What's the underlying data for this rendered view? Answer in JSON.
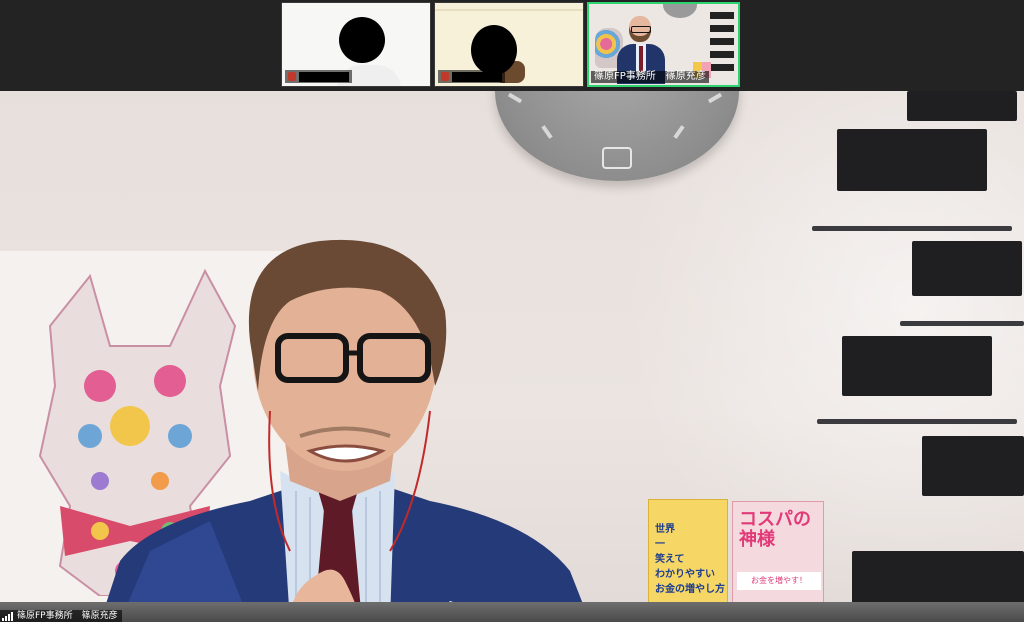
{
  "participants": [
    {
      "id": "p1",
      "name": ""
    },
    {
      "id": "p2",
      "name": ""
    }
  ],
  "self_tile": {
    "name": "篠原FP事務所　篠原充彦",
    "active_speaker_color": "#2dd36f"
  },
  "main_video": {
    "speaker_label": "篠原FP事務所　篠原充彦",
    "icons": {
      "signal": "signal-bars-icon",
      "mic": "mic-icon"
    }
  },
  "scene": {
    "book1_lines": [
      "世界",
      "一",
      "笑えて",
      "わかりやすい",
      "お金の増やし方"
    ],
    "book2_title": "コスパの神様",
    "book2_band": "お金を増やす！"
  }
}
